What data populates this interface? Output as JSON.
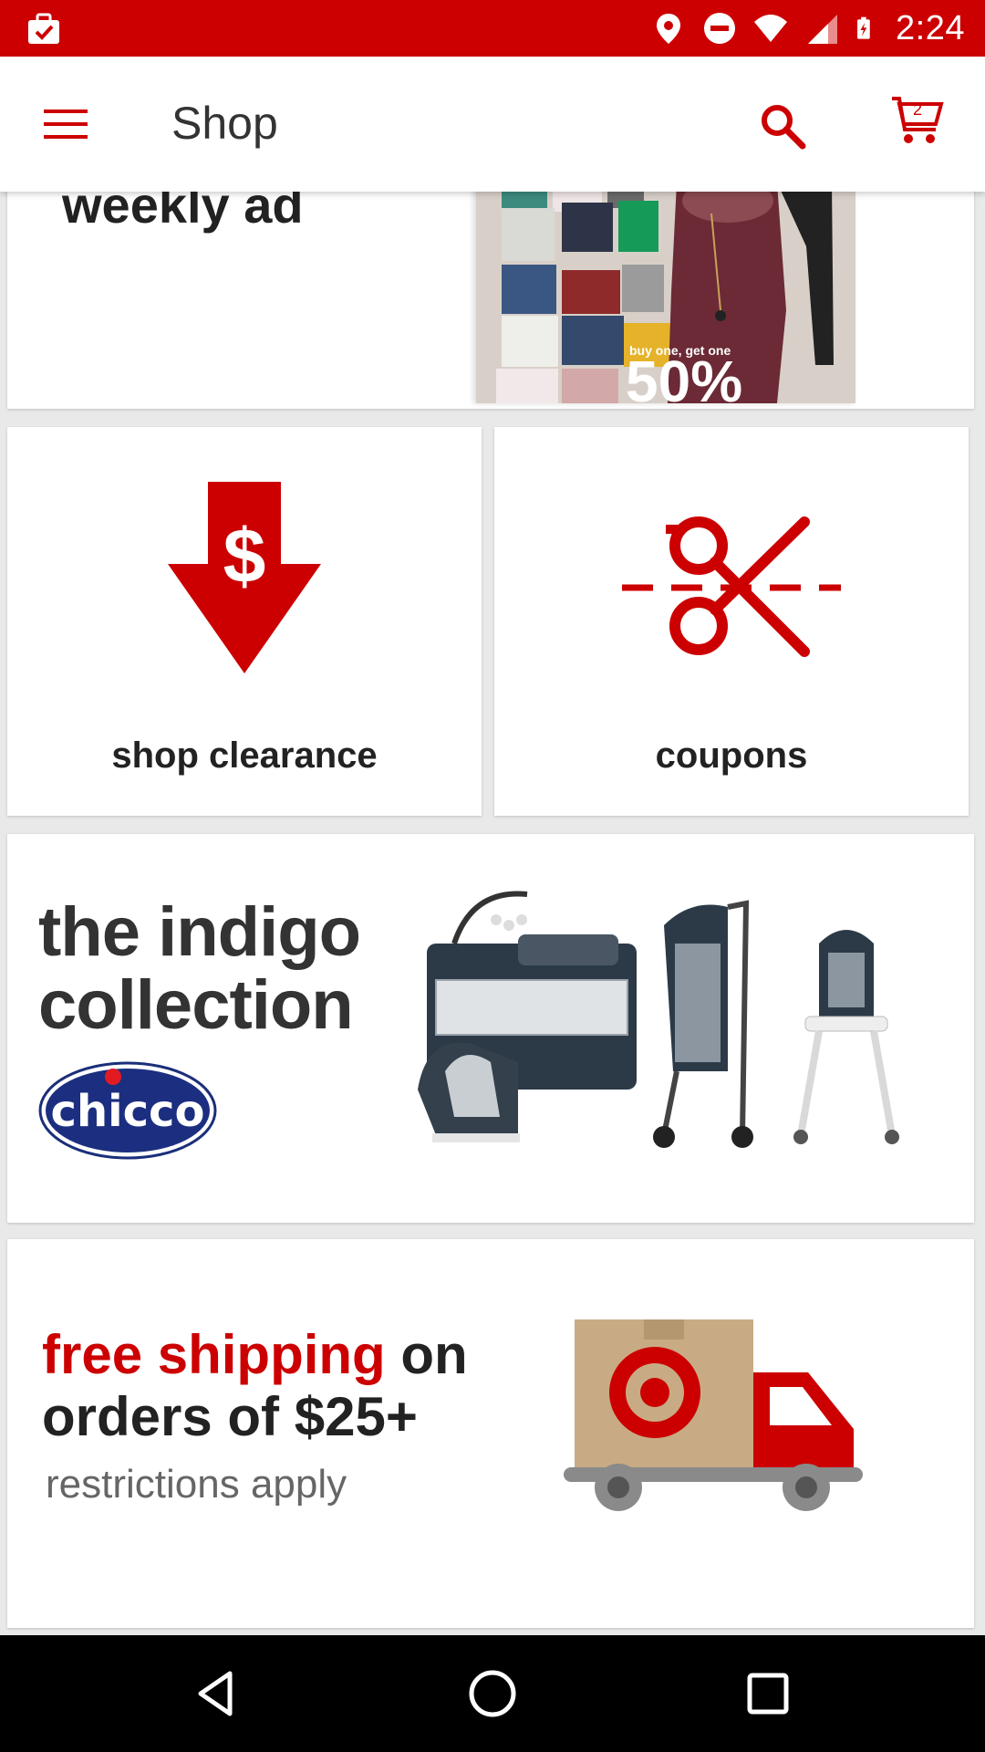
{
  "status_bar": {
    "time": "2:24",
    "icons": [
      "briefcase-check-icon",
      "location-pin-icon",
      "do-not-disturb-icon",
      "wifi-icon",
      "cell-signal-icon",
      "battery-charging-icon"
    ],
    "background": "#cc0000"
  },
  "app_bar": {
    "title": "Shop",
    "cart_count": "2",
    "icons": [
      "menu-icon",
      "search-icon",
      "cart-icon"
    ],
    "accent": "#cc0000"
  },
  "weekly_ad": {
    "heading": "weekly ad",
    "promo_small": "buy one, get one",
    "promo_big": "50%"
  },
  "tiles": [
    {
      "label": "shop clearance",
      "icon": "clearance-arrow-icon"
    },
    {
      "label": "coupons",
      "icon": "scissors-icon"
    }
  ],
  "indigo": {
    "headline_line1": "the indigo",
    "headline_line2": "collection",
    "logo_text": "chicco"
  },
  "shipping": {
    "accent_text": "free shipping",
    "text_rest": " on",
    "line2": "orders of $25+",
    "line3": "restrictions apply"
  },
  "nav_bar": {
    "icons": [
      "back-icon",
      "home-icon",
      "recents-icon"
    ]
  }
}
